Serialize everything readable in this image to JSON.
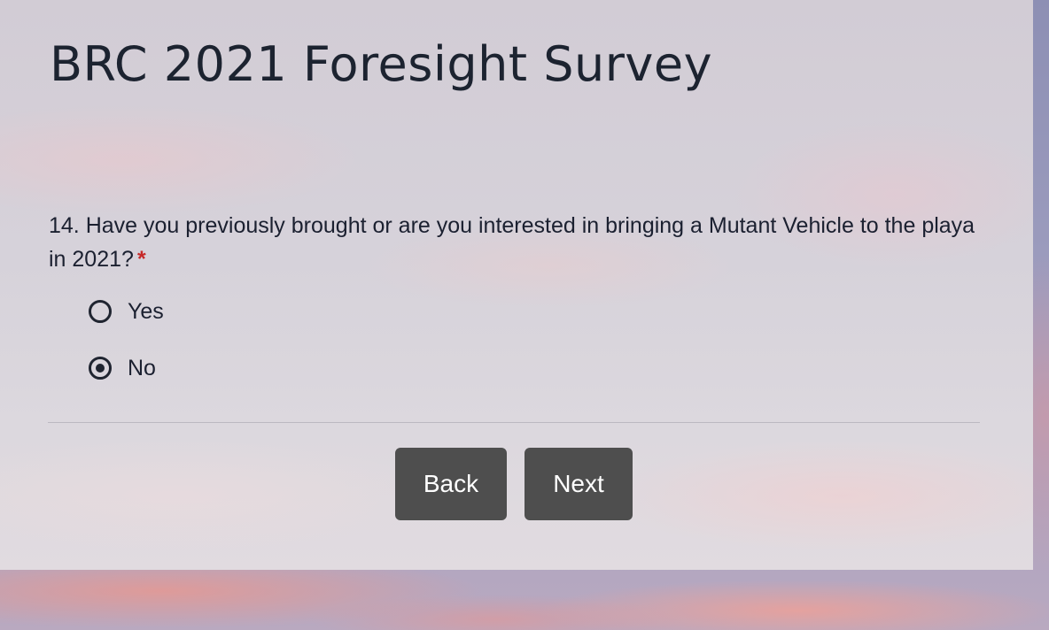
{
  "survey": {
    "title": "BRC 2021 Foresight Survey"
  },
  "question": {
    "text": "14. Have you previously brought or are you interested in bringing a Mutant Vehicle to the playa in 2021?",
    "required_marker": "*",
    "options": [
      {
        "label": "Yes",
        "selected": false
      },
      {
        "label": "No",
        "selected": true
      }
    ]
  },
  "navigation": {
    "back_label": "Back",
    "next_label": "Next"
  },
  "colors": {
    "button_bg": "#4e4e4e",
    "required": "#c62828",
    "text": "#1b2030"
  }
}
